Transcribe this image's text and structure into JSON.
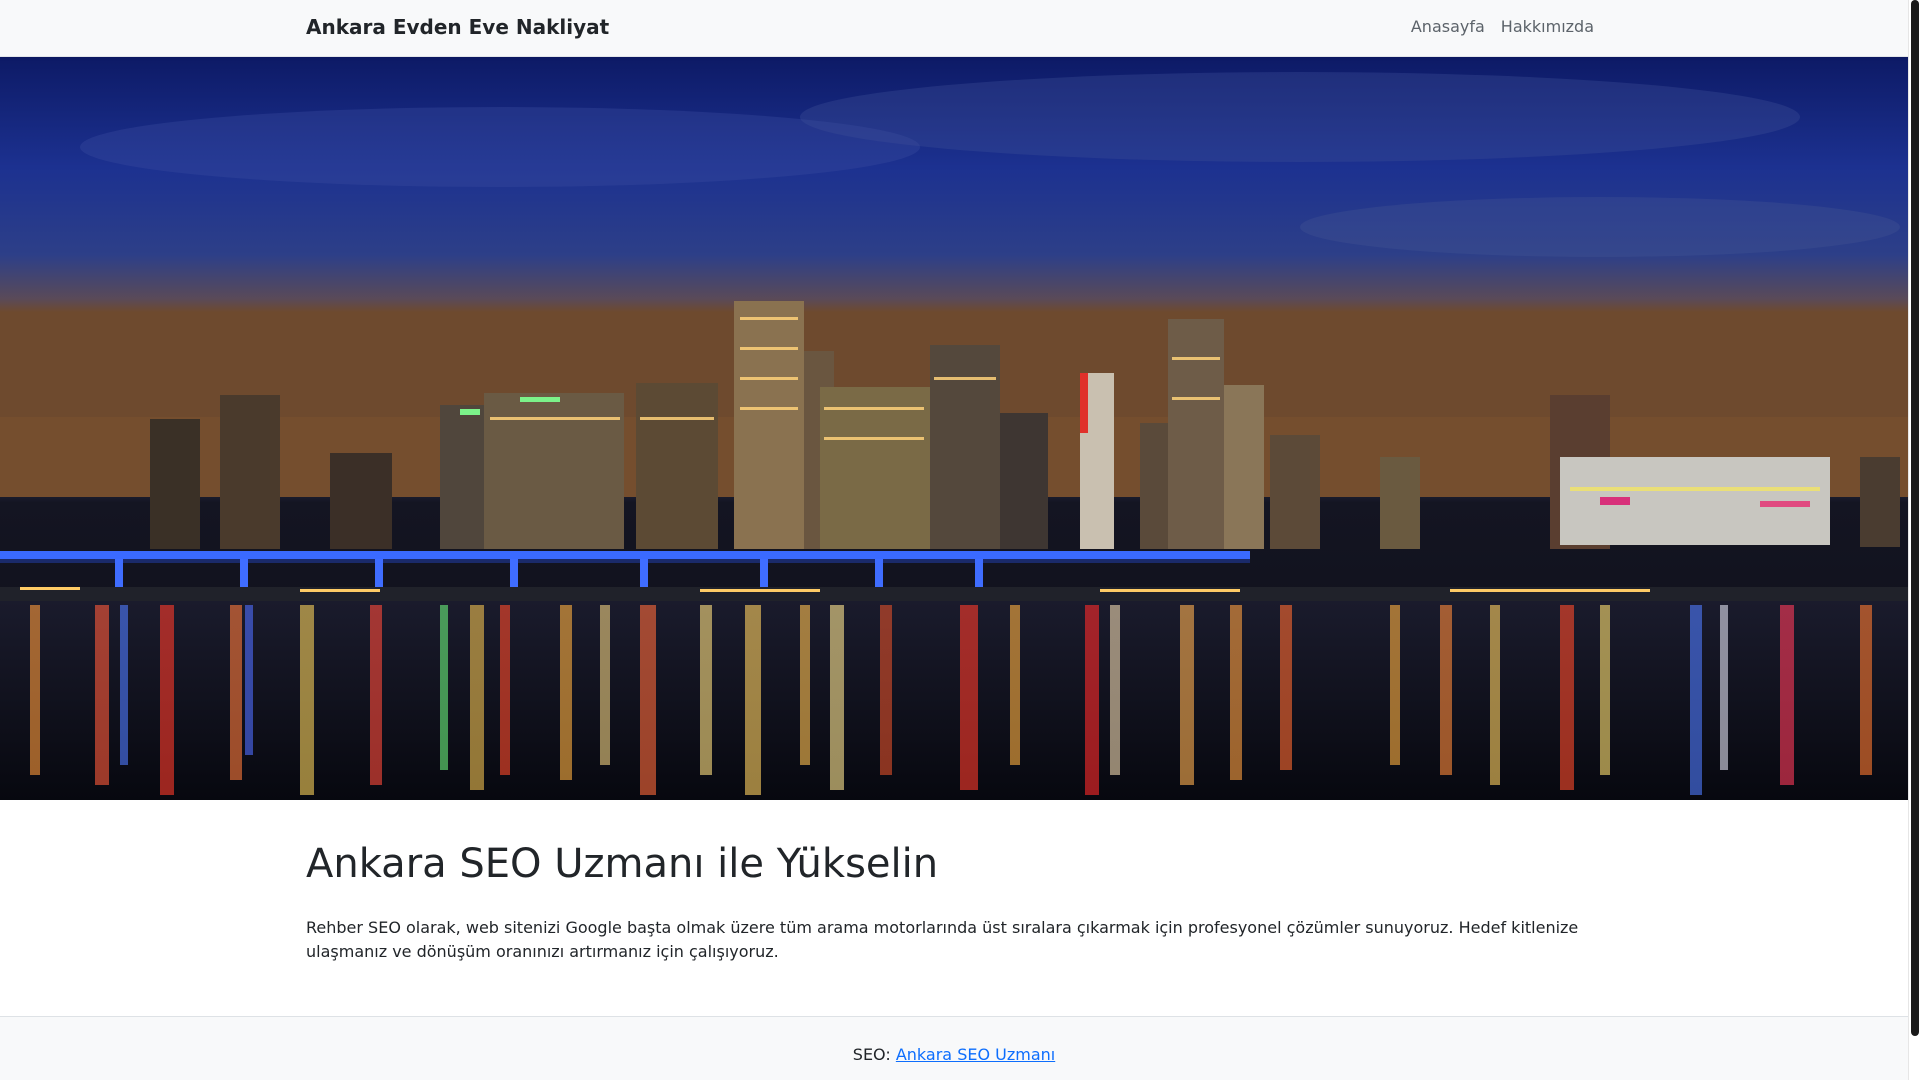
{
  "navbar": {
    "brand": "Ankara Evden Eve Nakliyat",
    "links": [
      {
        "label": "Anasayfa"
      },
      {
        "label": "Hakkımızda"
      }
    ]
  },
  "hero": {
    "image": "night-city-skyline-icon"
  },
  "main": {
    "heading": "Ankara SEO Uzmanı ile Yükselin",
    "paragraph": "Rehber SEO olarak, web sitenizi Google başta olmak üzere tüm arama motorlarında üst sıralara çıkarmak için profesyonel çözümler sunuyoruz. Hedef kitlenize ulaşmanız ve dönüşüm oranınızı artırmanız için çalışıyoruz."
  },
  "footer": {
    "prefix": "SEO:",
    "link_label": "Ankara SEO Uzmanı",
    "link_color": "#0d6efd"
  }
}
